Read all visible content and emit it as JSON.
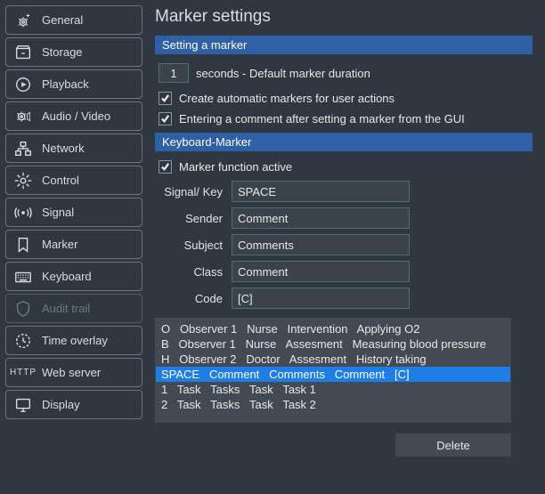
{
  "sidebar": {
    "items": [
      {
        "label": "General"
      },
      {
        "label": "Storage"
      },
      {
        "label": "Playback"
      },
      {
        "label": "Audio / Video"
      },
      {
        "label": "Network"
      },
      {
        "label": "Control"
      },
      {
        "label": "Signal"
      },
      {
        "label": "Marker"
      },
      {
        "label": "Keyboard"
      },
      {
        "label": "Audit trail"
      },
      {
        "label": "Time overlay"
      },
      {
        "label": "Web server"
      },
      {
        "label": "Display"
      }
    ]
  },
  "page": {
    "title": "Marker settings"
  },
  "sections": {
    "setting": "Setting a marker",
    "keyboard": "Keyboard-Marker"
  },
  "settingMarker": {
    "duration_value": "1",
    "duration_label": "seconds - Default marker duration",
    "auto_markers": {
      "checked": true,
      "label": "Create automatic markers for user actions"
    },
    "comment_after": {
      "checked": true,
      "label": "Entering a comment after setting a marker from the GUI"
    }
  },
  "keyboardMarker": {
    "active": {
      "checked": true,
      "label": "Marker function active"
    },
    "fields": {
      "signal_key": {
        "label": "Signal/ Key",
        "value": "SPACE"
      },
      "sender": {
        "label": "Sender",
        "value": "Comment"
      },
      "subject": {
        "label": "Subject",
        "value": "Comments"
      },
      "class": {
        "label": "Class",
        "value": "Comment"
      },
      "code": {
        "label": "Code",
        "value": "[C]"
      }
    },
    "list": [
      {
        "key": "O",
        "sender": "Observer 1",
        "subject": "Nurse",
        "class": "Intervention",
        "code": "Applying O2",
        "selected": false
      },
      {
        "key": "B",
        "sender": "Observer 1",
        "subject": "Nurse",
        "class": "Assesment",
        "code": "Measuring blood pressure",
        "selected": false
      },
      {
        "key": "H",
        "sender": "Observer 2",
        "subject": "Doctor",
        "class": "Assesment",
        "code": "History taking",
        "selected": false
      },
      {
        "key": "SPACE",
        "sender": "Comment",
        "subject": "Comments",
        "class": "Comment",
        "code": "[C]",
        "selected": true
      },
      {
        "key": "1",
        "sender": "Task",
        "subject": "Tasks",
        "class": "Task",
        "code": "Task 1",
        "selected": false
      },
      {
        "key": "2",
        "sender": "Task",
        "subject": "Tasks",
        "class": "Task",
        "code": "Task 2",
        "selected": false
      }
    ],
    "delete_label": "Delete"
  }
}
